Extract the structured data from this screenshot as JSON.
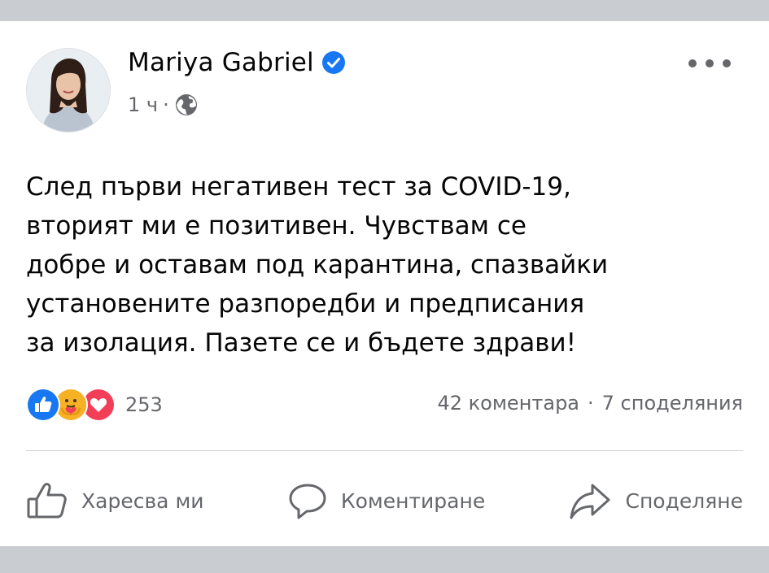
{
  "post": {
    "author": "Mariya Gabriel",
    "time": "1 ч",
    "separator": "·",
    "text": "След първи негативен тест за COVID-19,\nвторият ми е позитивен. Чувствам се\nдобре и оставам под карантина, спазвайки\nустановените разпоредби и предписания\nза изолация. Пазете се и бъдете здрави!",
    "reactions_count": "253",
    "comments": "42 коментара",
    "shares": "7 споделяния",
    "stats_separator": "·"
  },
  "actions": {
    "like": "Харесва ми",
    "comment": "Коментиране",
    "share": "Споделяне"
  },
  "icons": {
    "verified": "verified-badge-icon",
    "audience": "globe-icon",
    "reactions": [
      "like-reaction-icon",
      "care-reaction-icon",
      "love-reaction-icon"
    ]
  },
  "colors": {
    "like_blue": "#1877f2",
    "love_red": "#f33e58",
    "care_yellow": "#f7b125",
    "secondary_text": "#65676b",
    "page_background": "#c9ccd1"
  }
}
